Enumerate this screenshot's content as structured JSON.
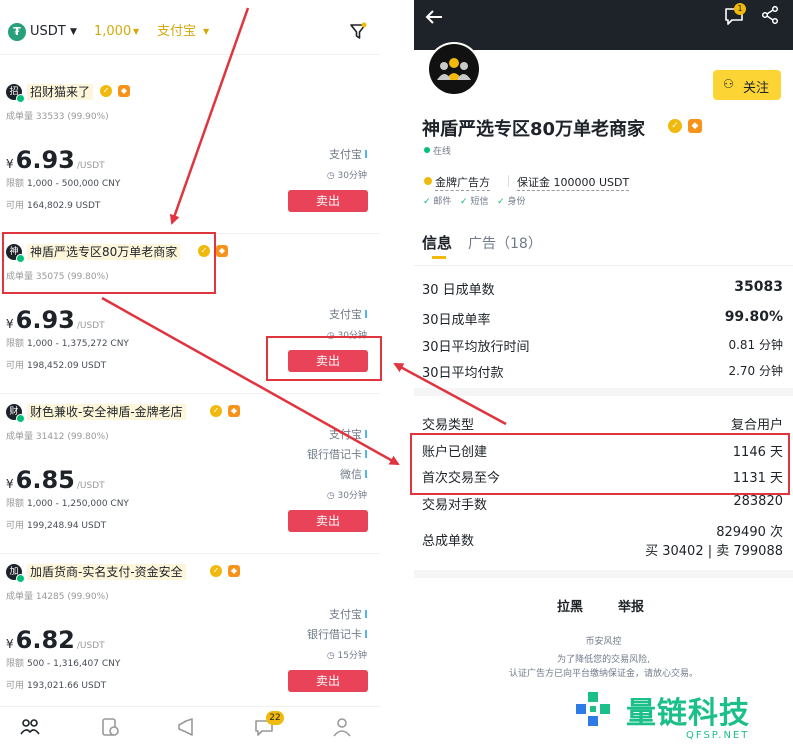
{
  "left": {
    "header": {
      "coin": "USDT",
      "amount": "1,000",
      "payment": "支付宝"
    },
    "ads": [
      {
        "name": "招财猫来了",
        "avatar": "招",
        "stats": "成单量 33533 (99.90%)",
        "price": "6.93",
        "unit": "/USDT",
        "limit_k": "限额",
        "limit_v": "1,000 - 500,000 CNY",
        "avail_k": "可用",
        "avail_v": "164,802.9 USDT",
        "methods": [
          "支付宝"
        ],
        "time": "30分钟",
        "sell": "卖出"
      },
      {
        "name": "神盾严选专区80万单老商家",
        "avatar": "神",
        "stats": "成单量 35075 (99.80%)",
        "price": "6.93",
        "unit": "/USDT",
        "limit_k": "限额",
        "limit_v": "1,000 - 1,375,272 CNY",
        "avail_k": "可用",
        "avail_v": "198,452.09 USDT",
        "methods": [
          "支付宝"
        ],
        "time": "30分钟",
        "sell": "卖出"
      },
      {
        "name": "财色兼收-安全神盾-金牌老店",
        "avatar": "财",
        "stats": "成单量 31412 (99.80%)",
        "price": "6.85",
        "unit": "/USDT",
        "limit_k": "限额",
        "limit_v": "1,000 - 1,250,000 CNY",
        "avail_k": "可用",
        "avail_v": "199,248.94 USDT",
        "methods": [
          "支付宝",
          "银行借记卡",
          "微信"
        ],
        "time": "30分钟",
        "sell": "卖出"
      },
      {
        "name": "加盾货商-实名支付-资金安全",
        "avatar": "加",
        "stats": "成单量 14285 (99.90%)",
        "price": "6.82",
        "unit": "/USDT",
        "limit_k": "限额",
        "limit_v": "500 - 1,316,407 CNY",
        "avail_k": "可用",
        "avail_v": "193,021.66 USDT",
        "methods": [
          "支付宝",
          "银行借记卡"
        ],
        "time": "15分钟",
        "sell": "卖出"
      }
    ],
    "nav": {
      "chat_badge": "22"
    },
    "currency_symbol": "¥"
  },
  "right": {
    "notif_badge": "1",
    "follow": "关注",
    "merchant_name": "神盾严选专区80万单老商家",
    "online": "在线",
    "gold_ad": "金牌广告方",
    "deposit": "保证金 100000 USDT",
    "verify": [
      "邮件",
      "短信",
      "身份"
    ],
    "tabs": [
      {
        "label": "信息"
      },
      {
        "label": "广告（18）"
      }
    ],
    "stats": [
      {
        "label": "30 日成单数",
        "value": "35083"
      },
      {
        "label": "30日成单率",
        "value": "99.80%"
      },
      {
        "label": "30日平均放行时间",
        "value": "0.81 分钟"
      },
      {
        "label": "30日平均付款",
        "value": "2.70 分钟"
      }
    ],
    "info": [
      {
        "label": "交易类型",
        "value": "复合用户"
      },
      {
        "label": "账户已创建",
        "value": "1146 天"
      },
      {
        "label": "首次交易至今",
        "value": "1131 天"
      },
      {
        "label": "交易对手数",
        "value": "283820"
      }
    ],
    "total_label": "总成单数",
    "total_value": "829490 次",
    "total_sub": "买 30402 | 卖 799088",
    "block": "拉黑",
    "report": "举报",
    "risk_title": "币安风控",
    "risk_text1": "为了降低您的交易风险,",
    "risk_text2": "认证广告方已向平台缴纳保证金，请放心交易。"
  },
  "watermark": {
    "text": "量链科技",
    "sub": "QFSP.NET"
  },
  "colors": {
    "accent": "#f0b90b",
    "sell": "#e94359",
    "highlight": "#e0343e",
    "dark": "#1e2329"
  }
}
